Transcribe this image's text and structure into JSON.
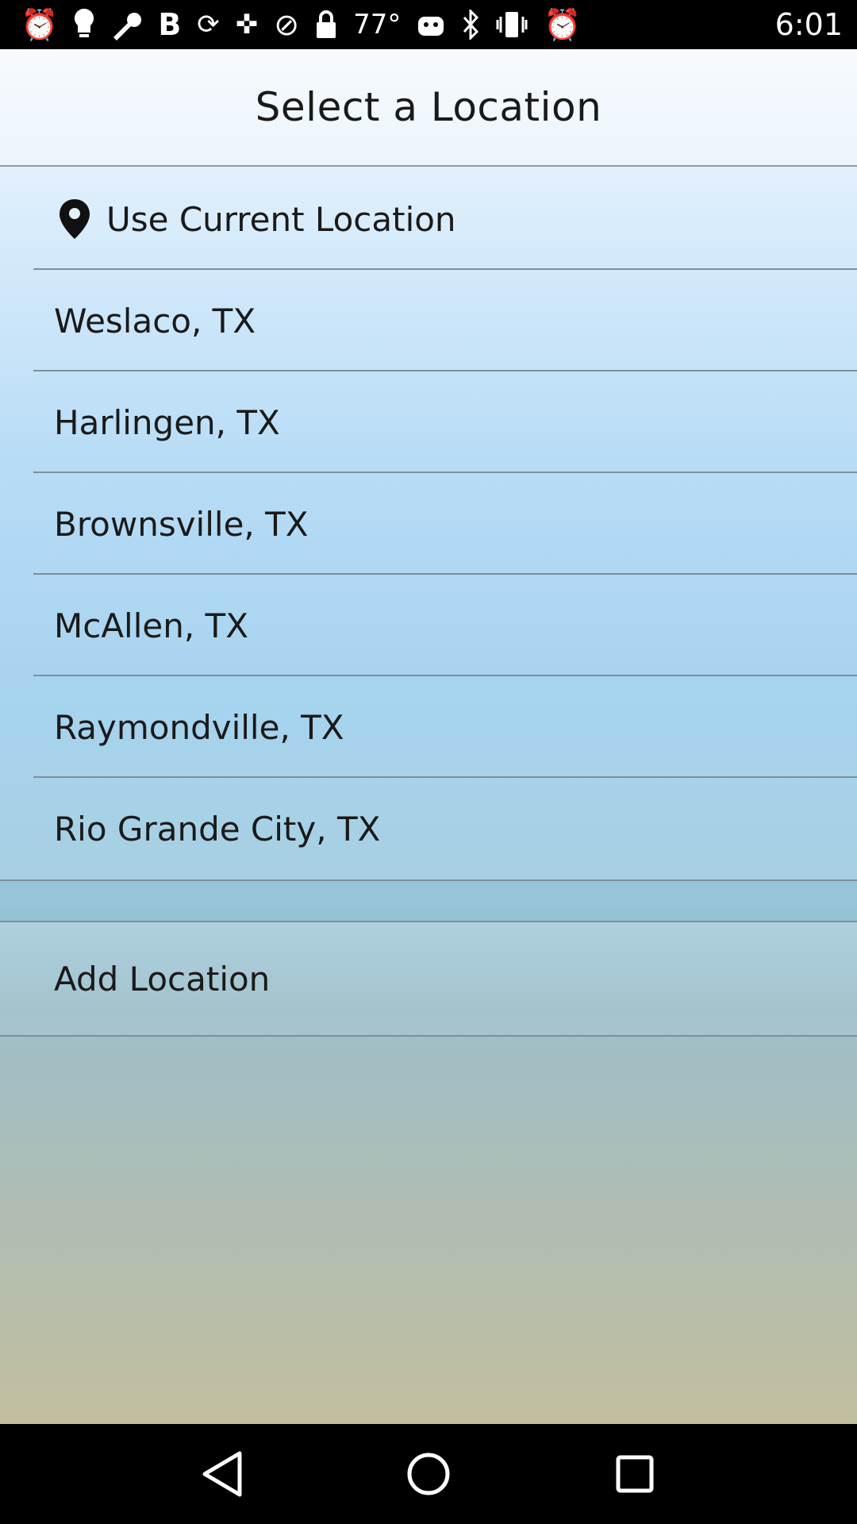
{
  "status_bar": {
    "temperature": "77°",
    "time": "6:01",
    "icons": [
      "alarm-icon",
      "bulb-icon",
      "wrench-icon",
      "bold-b-icon",
      "sync-icon",
      "gps-icon",
      "blocked-icon",
      "lock-icon",
      "battery-saver-icon",
      "bluetooth-icon",
      "vibrate-icon",
      "alarm-icon"
    ]
  },
  "header": {
    "title": "Select a Location"
  },
  "current_location": {
    "label": "Use Current Location",
    "icon": "map-pin-icon"
  },
  "locations": [
    {
      "label": "Weslaco, TX"
    },
    {
      "label": "Harlingen, TX"
    },
    {
      "label": "Brownsville, TX"
    },
    {
      "label": "McAllen, TX"
    },
    {
      "label": "Raymondville, TX"
    },
    {
      "label": "Rio Grande City, TX"
    }
  ],
  "add_location": {
    "label": "Add Location"
  },
  "nav": [
    "back-icon",
    "home-icon",
    "recents-icon"
  ]
}
